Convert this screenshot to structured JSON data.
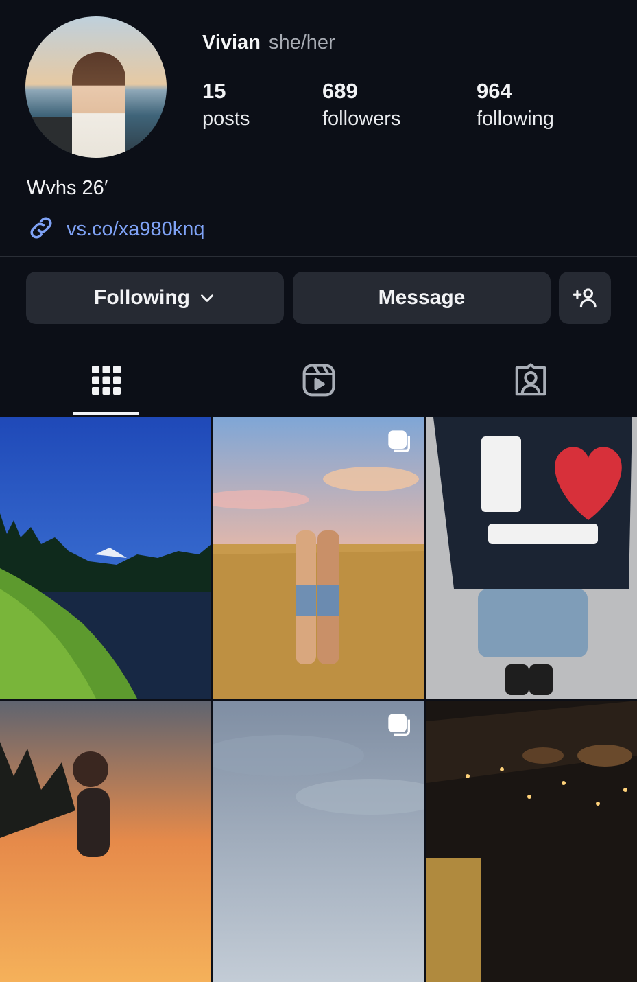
{
  "profile": {
    "name": "Vivian",
    "pronouns": "she/her",
    "bio": "Wvhs 26′",
    "link": "vs.co/xa980knq"
  },
  "stats": [
    {
      "value": "15",
      "label": "posts"
    },
    {
      "value": "689",
      "label": "followers"
    },
    {
      "value": "964",
      "label": "following"
    }
  ],
  "actions": {
    "following_label": "Following",
    "message_label": "Message"
  },
  "tabs": [
    "grid-icon",
    "reels-icon",
    "tagged-icon"
  ],
  "colors": {
    "background": "#0c0f17",
    "button": "#262a33",
    "link": "#7fa2f5"
  }
}
